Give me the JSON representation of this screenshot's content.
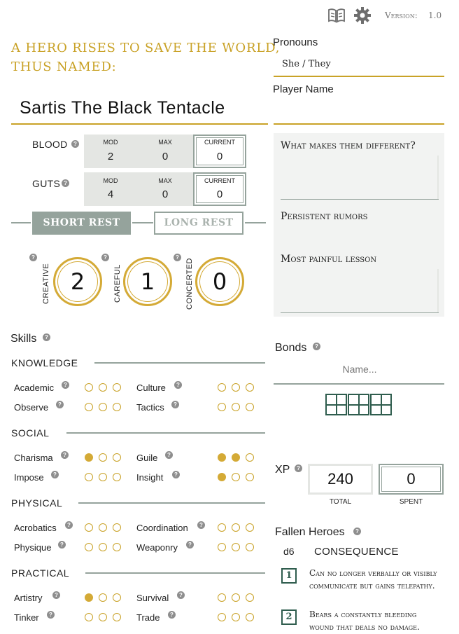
{
  "header": {
    "version_label": "Version:",
    "version_value": "1.0",
    "book_icon": "book-icon",
    "gear_icon": "gear-icon"
  },
  "hero": {
    "tagline_line1": "A HERO RISES TO SAVE THE WORLD,",
    "tagline_line2": "THUS NAMED:",
    "name": "Sartis The Black Tentacle"
  },
  "pronouns": {
    "label": "Pronouns",
    "value": "She / They"
  },
  "player_name": {
    "label": "Player Name",
    "value": ""
  },
  "stats": [
    {
      "label": "BLOOD",
      "mod_label": "MOD",
      "mod": "2",
      "max_label": "MAX",
      "max": "0",
      "current_label": "CURRENT",
      "current": "0"
    },
    {
      "label": "GUTS",
      "mod_label": "MOD",
      "mod": "4",
      "max_label": "MAX",
      "max": "0",
      "current_label": "CURRENT",
      "current": "0"
    }
  ],
  "rest": {
    "short": "SHORT REST",
    "long": "LONG REST"
  },
  "approaches": [
    {
      "label": "CREATIVE",
      "value": "2"
    },
    {
      "label": "CAREFUL",
      "value": "1"
    },
    {
      "label": "CONCERTED",
      "value": "0"
    }
  ],
  "questions": [
    {
      "label": "What makes them different?"
    },
    {
      "label": "Persistent rumors"
    },
    {
      "label": "Most painful lesson"
    }
  ],
  "skills": {
    "title": "Skills",
    "categories": [
      {
        "name": "KNOWLEDGE",
        "skills": [
          {
            "name": "Academic",
            "level": 0
          },
          {
            "name": "Culture",
            "level": 0
          },
          {
            "name": "Observe",
            "level": 0
          },
          {
            "name": "Tactics",
            "level": 0
          }
        ]
      },
      {
        "name": "SOCIAL",
        "skills": [
          {
            "name": "Charisma",
            "level": 1
          },
          {
            "name": "Guile",
            "level": 2
          },
          {
            "name": "Impose",
            "level": 0
          },
          {
            "name": "Insight",
            "level": 1
          }
        ]
      },
      {
        "name": "PHYSICAL",
        "skills": [
          {
            "name": "Acrobatics",
            "level": 0
          },
          {
            "name": "Coordination",
            "level": 0
          },
          {
            "name": "Physique",
            "level": 0
          },
          {
            "name": "Weaponry",
            "level": 0
          }
        ]
      },
      {
        "name": "PRACTICAL",
        "skills": [
          {
            "name": "Artistry",
            "level": 1
          },
          {
            "name": "Survival",
            "level": 0
          },
          {
            "name": "Tinker",
            "level": 0
          },
          {
            "name": "Trade",
            "level": 0
          }
        ]
      }
    ]
  },
  "bonds": {
    "title": "Bonds",
    "name_placeholder": "Name..."
  },
  "xp": {
    "label": "XP",
    "total": "240",
    "total_label": "TOTAL",
    "spent": "0",
    "spent_label": "SPENT"
  },
  "fallen": {
    "title": "Fallen Heroes",
    "die_label": "d6",
    "column_label": "CONSEQUENCE",
    "rows": [
      {
        "roll": "1",
        "text_line1": "Can no longer verbally or visibly",
        "text_line2": "communicate but gains telepathy."
      },
      {
        "roll": "2",
        "text_line1": "Bears a constantly bleeding",
        "text_line2": "wound that deals no damage."
      }
    ]
  },
  "colors": {
    "gold": "#c9a227",
    "green": "#2f5d4e",
    "gray_button": "#95a39c",
    "box_bg": "#e4e6e3"
  }
}
